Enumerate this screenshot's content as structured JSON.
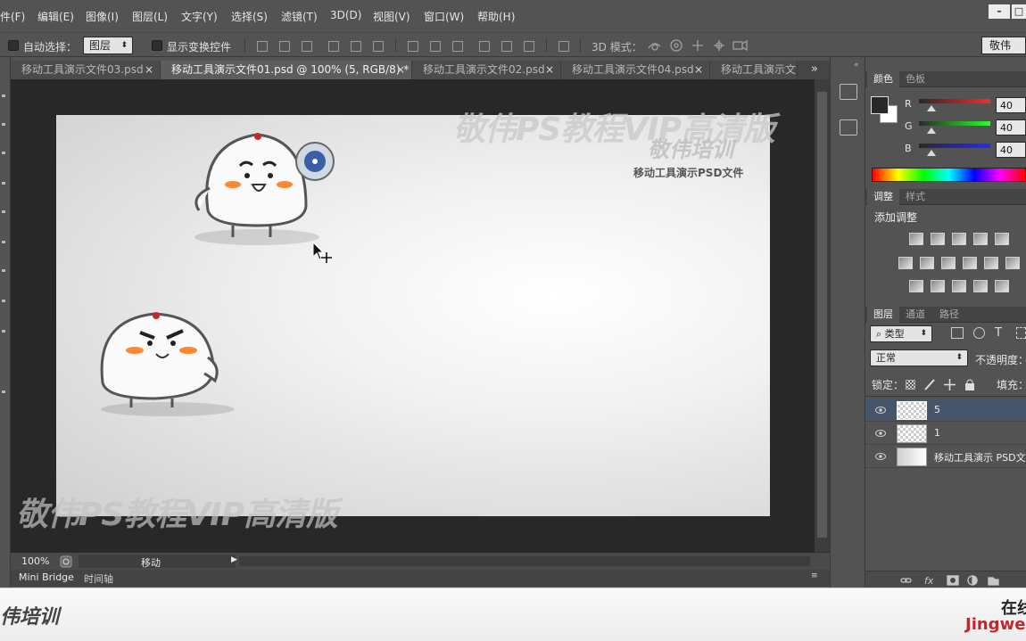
{
  "menubar": {
    "items": [
      "件(F)",
      "编辑(E)",
      "图像(I)",
      "图层(L)",
      "文字(Y)",
      "选择(S)",
      "滤镜(T)",
      "3D(D)",
      "视图(V)",
      "窗口(W)",
      "帮助(H)"
    ]
  },
  "window_buttons": {
    "minimize": "–",
    "restore": "□"
  },
  "options": {
    "auto_select_label": "自动选择：",
    "auto_select_value": "图层",
    "show_transform_label": "显示变换控件",
    "mode_3d_label": "3D 模式：",
    "workspace_preset": "敬伟"
  },
  "tabs": [
    {
      "label": "移动工具演示文件03.psd",
      "close": "×"
    },
    {
      "label": "移动工具演示文件01.psd @ 100% (5, RGB/8) *",
      "close": "×"
    },
    {
      "label": "移动工具演示文件02.psd",
      "close": "×"
    },
    {
      "label": "移动工具演示文件04.psd",
      "close": "×"
    },
    {
      "label": "移动工具演示文",
      "close": ""
    }
  ],
  "tabs_overflow": "»",
  "watermark": {
    "top_main": "敬伟PS教程VIP高清版",
    "top_sub": "敬伟培训",
    "bottom_main": "敬伟PS教程VIP高清版"
  },
  "canvas": {
    "caption": "移动工具演示PSD文件"
  },
  "status": {
    "zoom": "100%",
    "tool": "移动"
  },
  "bottom_tabs": [
    "Mini Bridge",
    "时间轴"
  ],
  "color_panel": {
    "tabs": [
      "颜色",
      "色板"
    ],
    "channels": [
      {
        "label": "R",
        "value": "40",
        "color": "#ff0000"
      },
      {
        "label": "G",
        "value": "40",
        "color": "#00ff00"
      },
      {
        "label": "B",
        "value": "40",
        "color": "#0000ff"
      }
    ]
  },
  "adjust_panel": {
    "tabs": [
      "调整",
      "样式"
    ],
    "title": "添加调整"
  },
  "layers_panel": {
    "tabs": [
      "图层",
      "通道",
      "路径"
    ],
    "filter_label": "类型",
    "blend_mode": "正常",
    "opacity_label": "不透明度：",
    "lock_label": "锁定：",
    "fill_label": "填充：",
    "layers": [
      {
        "name": "5",
        "selected": true,
        "thumb": "checker"
      },
      {
        "name": "1",
        "selected": false,
        "thumb": "checker"
      },
      {
        "name": "移动工具演示 PSD文",
        "selected": false,
        "thumb": "gradient"
      }
    ]
  },
  "banner": {
    "left_text": "伟培训",
    "right_text_cn": "在线",
    "right_text_en": "Jingwei"
  }
}
